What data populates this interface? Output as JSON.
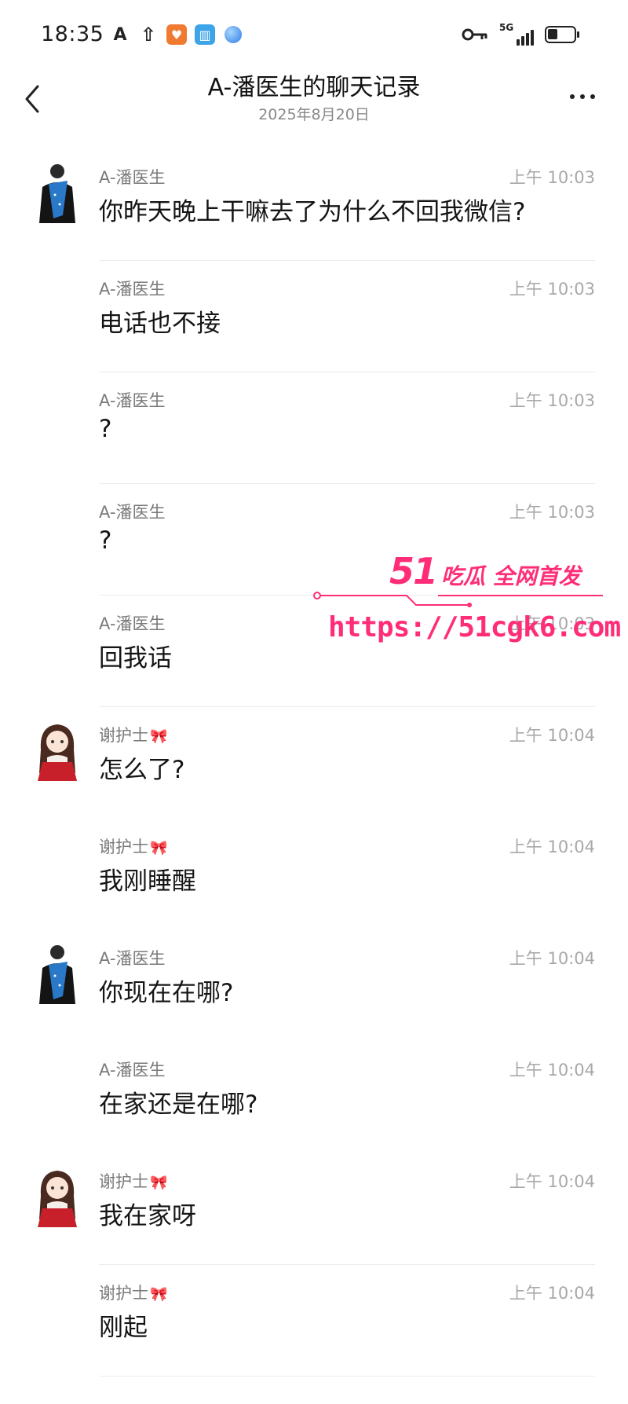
{
  "status_bar": {
    "time": "18:35",
    "network": "5G"
  },
  "header": {
    "title": "A-潘医生的聊天记录",
    "subtitle": "2025年8月20日"
  },
  "messages": [
    {
      "sender": "A-潘医生",
      "time": "上午 10:03",
      "text": "你昨天晚上干嘛去了为什么不回我微信?"
    },
    {
      "sender": "A-潘医生",
      "time": "上午 10:03",
      "text": "电话也不接"
    },
    {
      "sender": "A-潘医生",
      "time": "上午 10:03",
      "text": "?"
    },
    {
      "sender": "A-潘医生",
      "time": "上午 10:03",
      "text": "?"
    },
    {
      "sender": "A-潘医生",
      "time": "上午 10:03",
      "text": "回我话"
    },
    {
      "sender": "谢护士",
      "time": "上午 10:04",
      "text": "怎么了?"
    },
    {
      "sender": "谢护士",
      "time": "上午 10:04",
      "text": "我刚睡醒"
    },
    {
      "sender": "A-潘医生",
      "time": "上午 10:04",
      "text": "你现在在哪?"
    },
    {
      "sender": "A-潘医生",
      "time": "上午 10:04",
      "text": "在家还是在哪?"
    },
    {
      "sender": "谢护士",
      "time": "上午 10:04",
      "text": "我在家呀"
    },
    {
      "sender": "谢护士",
      "time": "上午 10:04",
      "text": "刚起"
    }
  ],
  "watermark": {
    "logo_number": "51",
    "logo_text": "吃瓜 全网首发",
    "url": "https://51cgk6.com"
  },
  "colors": {
    "watermark": "#ff2d78",
    "time_text": "#a8a8a8",
    "sender_text": "#7a7a7a"
  }
}
